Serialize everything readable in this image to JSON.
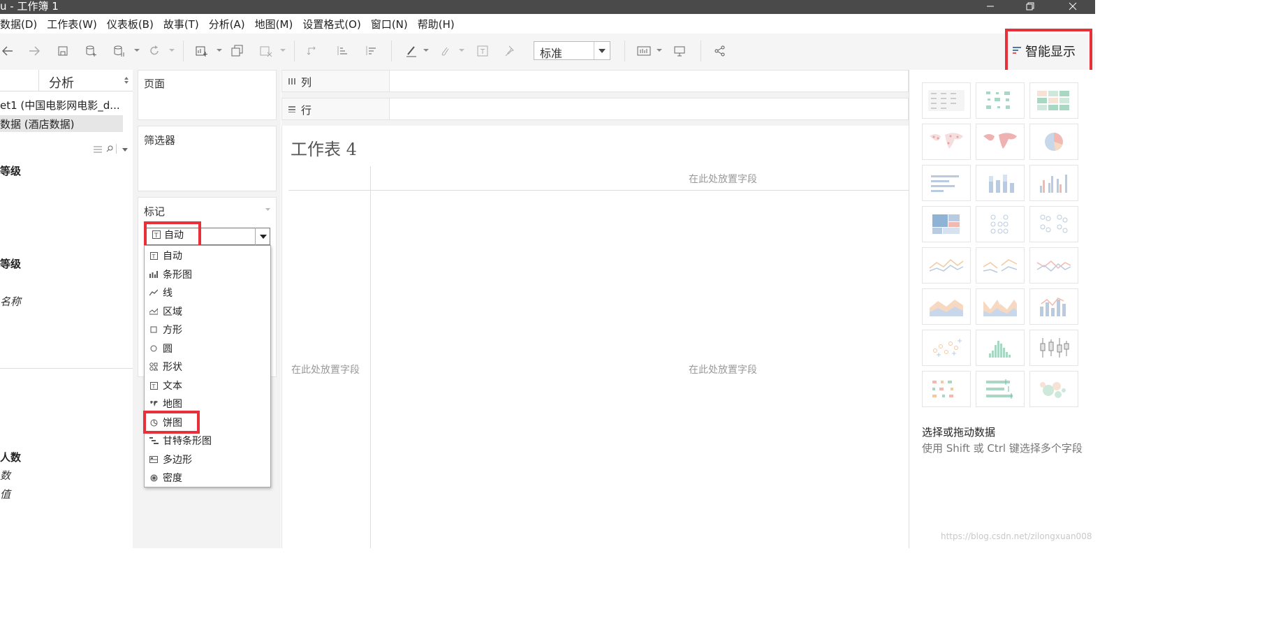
{
  "window": {
    "title": "u - 工作簿 1"
  },
  "menu": [
    "数据(D)",
    "工作表(W)",
    "仪表板(B)",
    "故事(T)",
    "分析(A)",
    "地图(M)",
    "设置格式(O)",
    "窗口(N)",
    "帮助(H)"
  ],
  "toolbar": {
    "view_select": "标准",
    "show_me": "智能显示"
  },
  "left_pane": {
    "tab_analysis": "分析",
    "datasource_1": "et1 (中国电影网电影_d...",
    "datasource_2": "数据 (酒店数据)",
    "dim_1": "等级",
    "dim_2": "等级",
    "dim_3": "名称",
    "measure_1": "人数",
    "measure_2": "数",
    "measure_3": "值"
  },
  "cards": {
    "pages": "页面",
    "filters": "筛选器",
    "marks": "标记",
    "mark_type_selected": "自动"
  },
  "mark_types": [
    "自动",
    "条形图",
    "线",
    "区域",
    "方形",
    "圆",
    "形状",
    "文本",
    "地图",
    "饼图",
    "甘特条形图",
    "多边形",
    "密度"
  ],
  "shelves": {
    "columns": "列",
    "rows": "行"
  },
  "worksheet": {
    "title": "工作表 4",
    "drop_top": "在此处放置字段",
    "drop_left": "在此处放置字段",
    "drop_center": "在此处放置字段"
  },
  "show_me": {
    "heading": "选择或拖动数据",
    "hint": "使用 Shift 或 Ctrl 键选择多个字段"
  },
  "watermark": "https://blog.csdn.net/zilongxuan008",
  "colors": {
    "highlight": "#e8303a",
    "accent_blue": "#4e79a7"
  }
}
